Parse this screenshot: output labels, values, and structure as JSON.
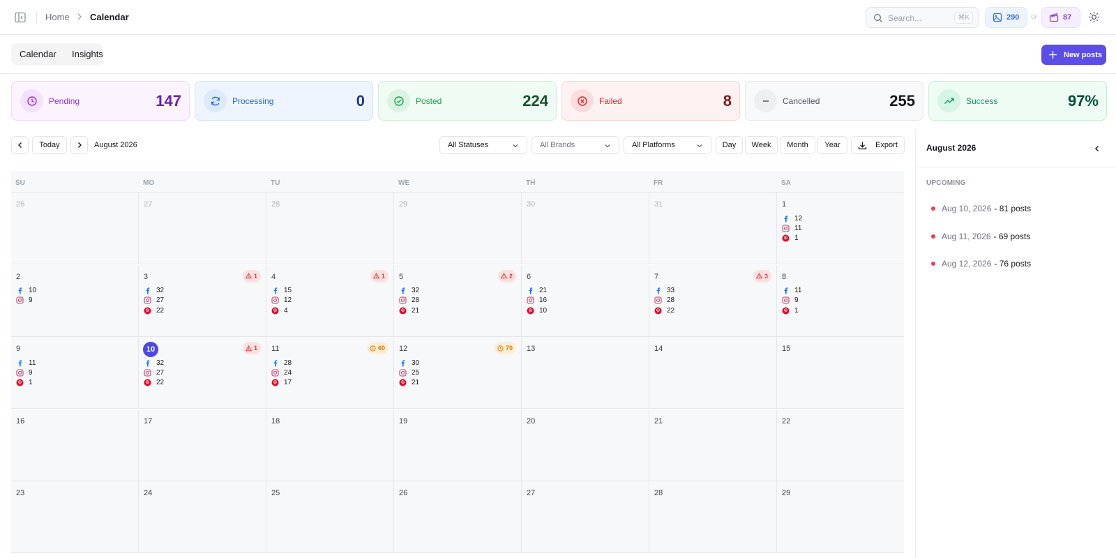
{
  "breadcrumb": {
    "home": "Home",
    "current": "Calendar"
  },
  "search": {
    "placeholder": "Search...",
    "shortcut": "⌘K"
  },
  "credits": {
    "images": "290",
    "separator": "or",
    "videos": "87"
  },
  "view_tabs": [
    "Calendar",
    "Insights"
  ],
  "new_posts_label": "New posts",
  "stats": [
    {
      "label": "Pending",
      "value": "147",
      "icon": "clock-icon",
      "bg": "#fbf3fe",
      "border": "#f0d9fb",
      "circle": "#f3e2fd",
      "color": "#9333ea",
      "valcolor": "#6b21a8"
    },
    {
      "label": "Processing",
      "value": "0",
      "icon": "refresh-icon",
      "bg": "#eff5fe",
      "border": "#d3e3fb",
      "circle": "#dde9fc",
      "color": "#2563eb",
      "valcolor": "#1e3a8a"
    },
    {
      "label": "Posted",
      "value": "224",
      "icon": "check-circle-icon",
      "bg": "#f0fbf3",
      "border": "#cdeed8",
      "circle": "#dcf3e3",
      "color": "#16a34a",
      "valcolor": "#14532d"
    },
    {
      "label": "Failed",
      "value": "8",
      "icon": "x-circle-icon",
      "bg": "#fef1f1",
      "border": "#f8d3d3",
      "circle": "#fbdcdc",
      "color": "#dc2626",
      "valcolor": "#7f1d1d"
    },
    {
      "label": "Cancelled",
      "value": "255",
      "icon": "minus-icon",
      "bg": "#f8f9fa",
      "border": "#e7e7ea",
      "circle": "#eeeff1",
      "color": "#4b5563",
      "valcolor": "#18181b"
    },
    {
      "label": "Success",
      "value": "97%",
      "icon": "trending-up-icon",
      "bg": "#eefcf4",
      "border": "#c6efd8",
      "circle": "#d6f5e4",
      "color": "#059669",
      "valcolor": "#064e3b"
    }
  ],
  "toolbar": {
    "today": "Today",
    "month_label": "August 2026",
    "filters": [
      "All Statuses",
      "All Brands",
      "All Platforms"
    ],
    "views": [
      "Day",
      "Week",
      "Month",
      "Year"
    ],
    "export": "Export"
  },
  "weekdays": [
    "SU",
    "MO",
    "TU",
    "WE",
    "TH",
    "FR",
    "SA"
  ],
  "weeks": [
    [
      {
        "d": "26",
        "out": true
      },
      {
        "d": "27",
        "out": true
      },
      {
        "d": "28",
        "out": true
      },
      {
        "d": "29",
        "out": true
      },
      {
        "d": "30",
        "out": true
      },
      {
        "d": "31",
        "out": true
      },
      {
        "d": "1",
        "fb": "12",
        "ig": "11",
        "pin": "1"
      }
    ],
    [
      {
        "d": "2",
        "fb": "10",
        "ig": "9"
      },
      {
        "d": "3",
        "fb": "32",
        "ig": "27",
        "pin": "22",
        "badge": {
          "type": "warn",
          "n": "1"
        }
      },
      {
        "d": "4",
        "fb": "15",
        "ig": "12",
        "pin": "4",
        "badge": {
          "type": "warn",
          "n": "1"
        }
      },
      {
        "d": "5",
        "fb": "32",
        "ig": "28",
        "pin": "21",
        "badge": {
          "type": "warn",
          "n": "2"
        }
      },
      {
        "d": "6",
        "fb": "21",
        "ig": "16",
        "pin": "10"
      },
      {
        "d": "7",
        "fb": "33",
        "ig": "28",
        "pin": "22",
        "badge": {
          "type": "warn",
          "n": "3"
        }
      },
      {
        "d": "8",
        "fb": "11",
        "ig": "9",
        "pin": "1"
      }
    ],
    [
      {
        "d": "9",
        "fb": "11",
        "ig": "9",
        "pin": "1"
      },
      {
        "d": "10",
        "today": true,
        "fb": "32",
        "ig": "27",
        "pin": "22",
        "badge": {
          "type": "warn",
          "n": "1"
        }
      },
      {
        "d": "11",
        "fb": "28",
        "ig": "24",
        "pin": "17",
        "badge": {
          "type": "sched",
          "n": "60"
        }
      },
      {
        "d": "12",
        "fb": "30",
        "ig": "25",
        "pin": "21",
        "badge": {
          "type": "sched",
          "n": "70"
        }
      },
      {
        "d": "13"
      },
      {
        "d": "14"
      },
      {
        "d": "15"
      }
    ],
    [
      {
        "d": "16"
      },
      {
        "d": "17"
      },
      {
        "d": "18"
      },
      {
        "d": "19"
      },
      {
        "d": "20"
      },
      {
        "d": "21"
      },
      {
        "d": "22"
      }
    ],
    [
      {
        "d": "23"
      },
      {
        "d": "24"
      },
      {
        "d": "25"
      },
      {
        "d": "26"
      },
      {
        "d": "27"
      },
      {
        "d": "28"
      },
      {
        "d": "29"
      }
    ]
  ],
  "side_panel": {
    "title": "August 2026",
    "section": "UPCOMING",
    "items": [
      {
        "date": "Aug 10, 2026",
        "count": "- 81 posts"
      },
      {
        "date": "Aug 11, 2026",
        "count": "- 69 posts"
      },
      {
        "date": "Aug 12, 2026",
        "count": "- 76 posts"
      }
    ]
  },
  "colors": {
    "accent": "#5b4de6",
    "facebook": "#1877f2",
    "instagram": "#e1306c",
    "pinterest": "#e60023"
  }
}
